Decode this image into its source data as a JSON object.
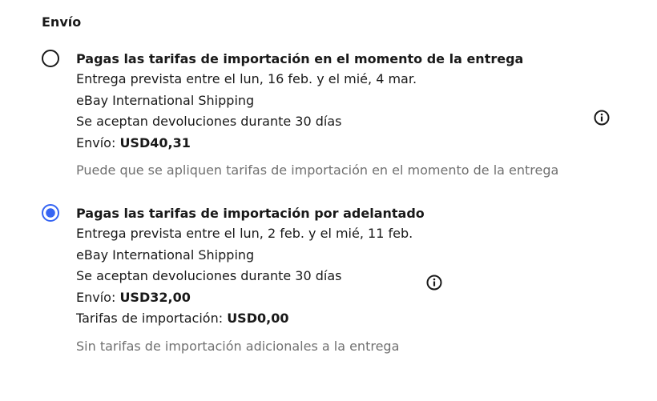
{
  "section": {
    "title": "Envío"
  },
  "options": [
    {
      "selected": false,
      "title": "Pagas las tarifas de importación en el momento de la entrega",
      "delivery": "Entrega prevista entre el lun, 16 feb. y el mié, 4 mar.",
      "carrier": "eBay International Shipping",
      "returns": "Se aceptan devoluciones durante 30 días",
      "shipping_label": "Envío: ",
      "shipping_value": "USD40,31",
      "note": "Puede que se apliquen tarifas de importación en el momento de la entrega",
      "icon": "info-icon"
    },
    {
      "selected": true,
      "title": "Pagas las tarifas de importación por adelantado",
      "delivery": "Entrega prevista entre el lun, 2 feb. y el mié, 11 feb.",
      "carrier": "eBay International Shipping",
      "returns": "Se aceptan devoluciones durante 30 días",
      "shipping_label": "Envío: ",
      "shipping_value": "USD32,00",
      "import_label": "Tarifas de importación: ",
      "import_value": "USD0,00",
      "note": "Sin tarifas de importación adicionales a la entrega",
      "icon": "info-icon"
    }
  ],
  "colors": {
    "text": "#191919",
    "muted": "#707070",
    "accent": "#3665f3"
  }
}
